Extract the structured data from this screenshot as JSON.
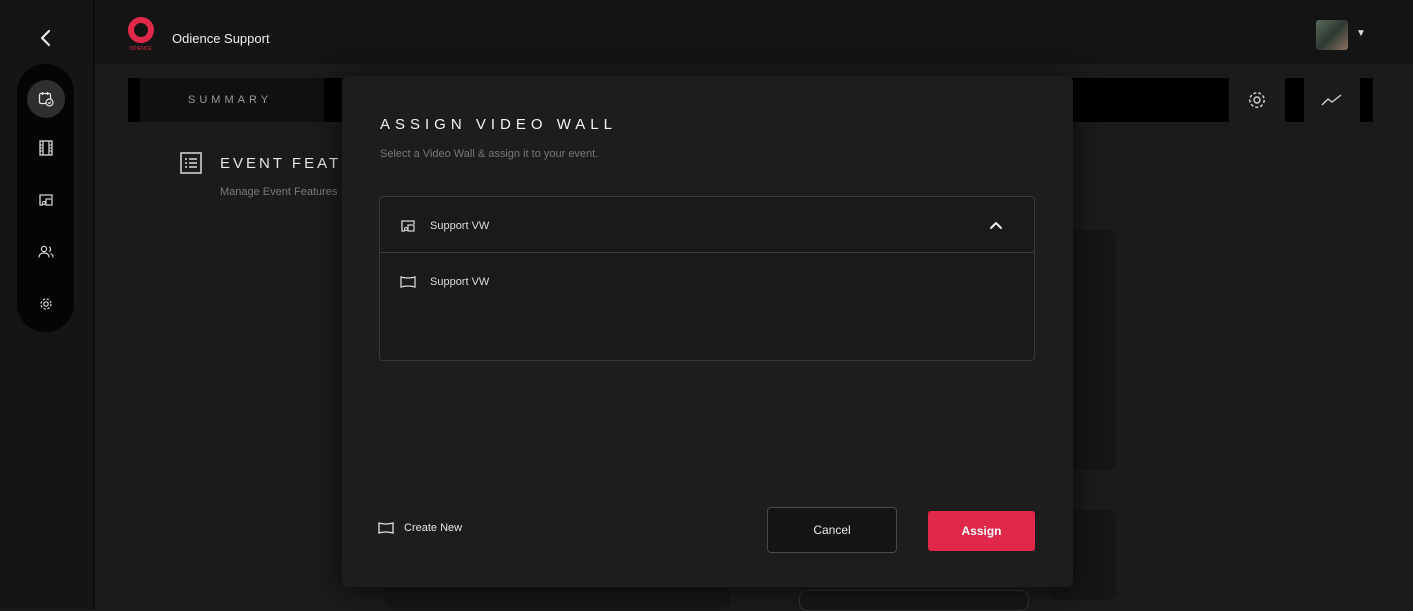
{
  "app": {
    "brand_name": "Odience Support",
    "logo_caption": "ODIENCE"
  },
  "tabs": {
    "summary_label": "SUMMARY",
    "settings_icon": "gear-icon",
    "analytics_icon": "trend-line-icon"
  },
  "section": {
    "title": "EVENT FEATU",
    "subtitle": "Manage Event Features"
  },
  "sidebar": {
    "items": [
      {
        "icon": "calendar-check-icon",
        "active": true
      },
      {
        "icon": "film-icon",
        "active": false
      },
      {
        "icon": "video-wall-icon",
        "active": false
      },
      {
        "icon": "users-icon",
        "active": false
      },
      {
        "icon": "gear-icon",
        "active": false
      }
    ]
  },
  "modal": {
    "title": "ASSIGN VIDEO WALL",
    "subtitle": "Select a Video Wall & assign it to your event.",
    "dropdown": {
      "selected_label": "Support VW",
      "options": [
        {
          "label": "Support VW",
          "icon": "screen-icon"
        }
      ]
    },
    "create_new_label": "Create New",
    "cancel_label": "Cancel",
    "assign_label": "Assign"
  },
  "colors": {
    "accent": "#e0284a",
    "background": "#1b1b1b",
    "modal": "#1d1d1d"
  }
}
